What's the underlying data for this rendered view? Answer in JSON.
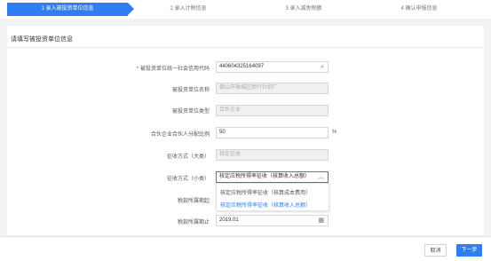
{
  "steps": [
    {
      "label": "1 录入被投资单位信息"
    },
    {
      "label": "2 录入计税信息"
    },
    {
      "label": "3 录入减免税额"
    },
    {
      "label": "4 确认申报信息"
    }
  ],
  "section": {
    "title": "请填写被投资单位信息"
  },
  "form": {
    "credit_code": {
      "label": "被投资单位统一社会信用代码",
      "value": "440604325164097"
    },
    "unit_name": {
      "label": "被投资单位名称",
      "value": "佛山市禅城区颜行针织厂"
    },
    "unit_type": {
      "label": "被投资单位类型",
      "value": "合伙企业"
    },
    "ratio": {
      "label": "合伙企业合伙人分配比例",
      "value": "50",
      "suffix": "%"
    },
    "collect_big": {
      "label": "征收方式（大类）",
      "value": "核定征收"
    },
    "collect_small": {
      "label": "征收方式（小类）",
      "value": "核定应税所得率征收（核算收入总额）"
    },
    "period_start": {
      "label": "税款所属期起",
      "value": ""
    },
    "period_end": {
      "label": "税款所属期止",
      "value": "2019.01"
    }
  },
  "dropdown": {
    "options": [
      {
        "label": "核定应税所得率征收（核算成本费用）"
      },
      {
        "label": "核定应税所得率征收（核算收入总额）"
      }
    ],
    "selected": 1
  },
  "footer": {
    "cancel": "取消",
    "next": "下一步"
  },
  "colors": {
    "primary": "#2f7ff2",
    "required": "#ee3333"
  }
}
